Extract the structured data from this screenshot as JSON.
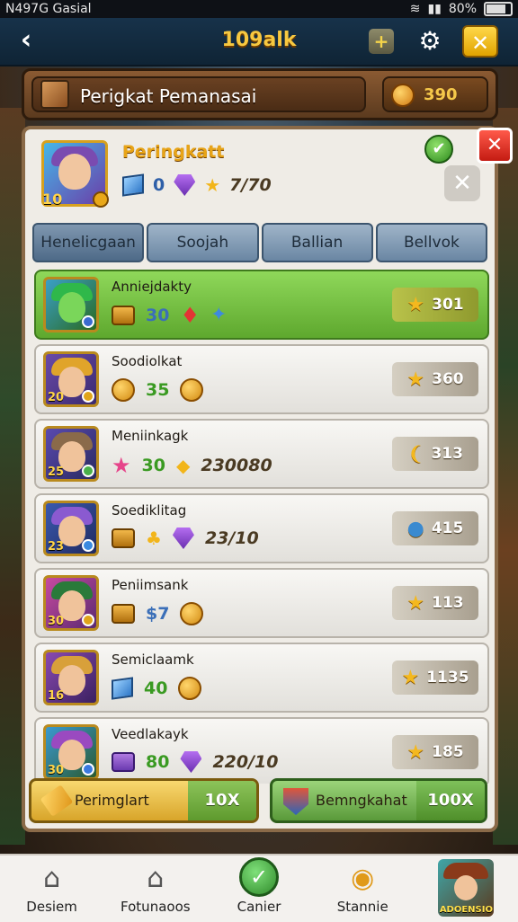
{
  "status_bar": {
    "left_text": "N497G Gasial",
    "battery": "80%"
  },
  "topbar": {
    "title": "109alk",
    "plus_label": "+",
    "close_label": "✕"
  },
  "banner": {
    "title": "Perigkat Pemanasai",
    "coins": "390"
  },
  "profile": {
    "name": "Peringkatt",
    "level": "10",
    "stat_cube": "0",
    "stat_points": "7/70"
  },
  "tabs": [
    "Henelicgaan",
    "Soojah",
    "Ballian",
    "Bellvok"
  ],
  "rows": [
    {
      "name": "Anniejdakty",
      "level": "",
      "badge": "",
      "value1": "30",
      "value2": "",
      "score": "301",
      "highlight": true
    },
    {
      "name": "Soodiolkat",
      "level": "20",
      "value1": "35",
      "value2": "",
      "score": "360",
      "highlight": false
    },
    {
      "name": "Meniinkagk",
      "level": "25",
      "value1": "30",
      "value2": "230080",
      "score": "313",
      "highlight": false
    },
    {
      "name": "Soediklitag",
      "level": "23",
      "value1": "",
      "value2": "23/10",
      "score": "415",
      "highlight": false
    },
    {
      "name": "Peniimsank",
      "level": "30",
      "value1": "$7",
      "value2": "",
      "score": "113",
      "highlight": false
    },
    {
      "name": "Semiclaamk",
      "level": "16",
      "value1": "40",
      "value2": "",
      "score": "1135",
      "highlight": false
    },
    {
      "name": "Veedlakayk",
      "level": "30",
      "value1": "80",
      "value2": "220/10",
      "score": "185",
      "highlight": false
    }
  ],
  "footer": {
    "left_label": "Perimglart",
    "left_count": "10X",
    "right_label": "Bemngkahat",
    "right_count": "100X"
  },
  "bottom_nav": {
    "items": [
      "Desiem",
      "Fotunaoos",
      "Canier",
      "Stannie"
    ],
    "hero_label": "ADOENSIO"
  },
  "colors": {
    "accent": "#f7c840",
    "highlight_row": "#7ccc48",
    "panel": "#efece6"
  }
}
